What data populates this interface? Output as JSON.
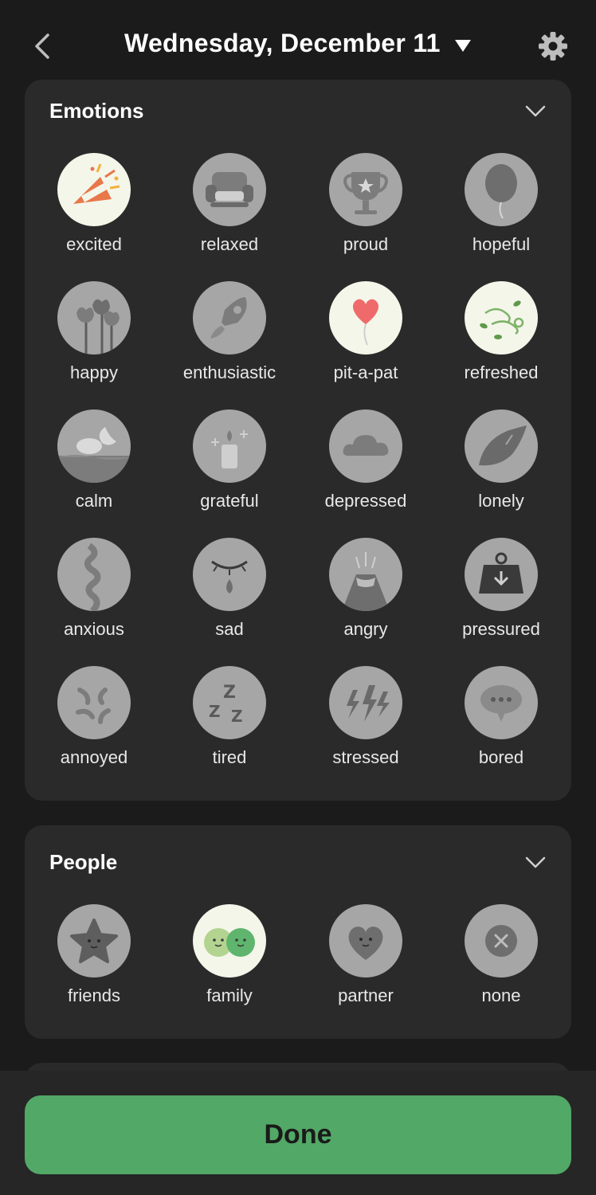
{
  "header": {
    "title": "Wednesday, December 11"
  },
  "emotions": {
    "title": "Emotions",
    "items": [
      {
        "label": "excited",
        "icon": "party-popper-icon",
        "selected": true
      },
      {
        "label": "relaxed",
        "icon": "armchair-icon",
        "selected": false
      },
      {
        "label": "proud",
        "icon": "trophy-icon",
        "selected": false
      },
      {
        "label": "hopeful",
        "icon": "balloon-icon",
        "selected": false
      },
      {
        "label": "happy",
        "icon": "tulips-icon",
        "selected": false
      },
      {
        "label": "enthusiastic",
        "icon": "rocket-icon",
        "selected": false
      },
      {
        "label": "pit-a-pat",
        "icon": "heart-balloon-icon",
        "selected": true
      },
      {
        "label": "refreshed",
        "icon": "breeze-icon",
        "selected": true
      },
      {
        "label": "calm",
        "icon": "moon-cloud-icon",
        "selected": false
      },
      {
        "label": "grateful",
        "icon": "candle-icon",
        "selected": false
      },
      {
        "label": "depressed",
        "icon": "cloud-icon",
        "selected": false
      },
      {
        "label": "lonely",
        "icon": "leaf-icon",
        "selected": false
      },
      {
        "label": "anxious",
        "icon": "rope-icon",
        "selected": false
      },
      {
        "label": "sad",
        "icon": "teardrop-icon",
        "selected": false
      },
      {
        "label": "angry",
        "icon": "volcano-icon",
        "selected": false
      },
      {
        "label": "pressured",
        "icon": "weight-icon",
        "selected": false
      },
      {
        "label": "annoyed",
        "icon": "annoyed-marks-icon",
        "selected": false
      },
      {
        "label": "tired",
        "icon": "zzz-icon",
        "selected": false
      },
      {
        "label": "stressed",
        "icon": "lightning-icon",
        "selected": false
      },
      {
        "label": "bored",
        "icon": "speech-bubble-icon",
        "selected": false
      }
    ]
  },
  "people": {
    "title": "People",
    "items": [
      {
        "label": "friends",
        "icon": "star-face-icon",
        "selected": false
      },
      {
        "label": "family",
        "icon": "two-faces-icon",
        "selected": true
      },
      {
        "label": "partner",
        "icon": "heart-face-icon",
        "selected": false
      },
      {
        "label": "none",
        "icon": "x-circle-icon",
        "selected": false
      }
    ]
  },
  "footer": {
    "done_label": "Done"
  },
  "colors": {
    "accent": "#52a866",
    "card": "#2a2a2a",
    "background": "#1b1b1b",
    "selected_circle": "#f4f6ea",
    "unselected_circle": "#a6a6a6"
  }
}
